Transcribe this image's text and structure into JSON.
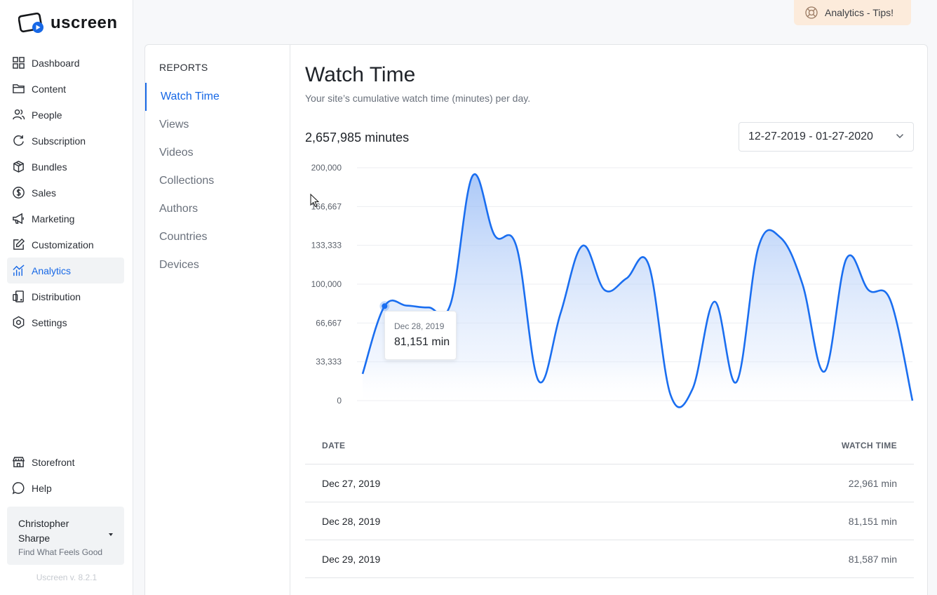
{
  "app": {
    "logo_text": "uscreen",
    "version": "Uscreen v. 8.2.1"
  },
  "sidebar": {
    "items": [
      {
        "label": "Dashboard",
        "icon": "grid-icon"
      },
      {
        "label": "Content",
        "icon": "folder-icon"
      },
      {
        "label": "People",
        "icon": "people-icon"
      },
      {
        "label": "Subscription",
        "icon": "refresh-icon"
      },
      {
        "label": "Bundles",
        "icon": "box-icon"
      },
      {
        "label": "Sales",
        "icon": "dollar-icon"
      },
      {
        "label": "Marketing",
        "icon": "megaphone-icon"
      },
      {
        "label": "Customization",
        "icon": "edit-icon"
      },
      {
        "label": "Analytics",
        "icon": "chart-icon",
        "active": true
      },
      {
        "label": "Distribution",
        "icon": "devices-icon"
      },
      {
        "label": "Settings",
        "icon": "hexagon-gear-icon"
      }
    ],
    "bottom": [
      {
        "label": "Storefront",
        "icon": "store-icon"
      },
      {
        "label": "Help",
        "icon": "chat-icon"
      }
    ],
    "user": {
      "name": "Christopher Sharpe",
      "subtitle": "Find What Feels Good"
    }
  },
  "header": {
    "tips_label": "Analytics - Tips!"
  },
  "reports": {
    "title": "REPORTS",
    "items": [
      "Watch Time",
      "Views",
      "Videos",
      "Collections",
      "Authors",
      "Countries",
      "Devices"
    ],
    "active": "Watch Time"
  },
  "main": {
    "title": "Watch Time",
    "subtitle": "Your site’s cumulative watch time (minutes) per day.",
    "total": "2,657,985 minutes",
    "date_range": "12-27-2019 - 01-27-2020"
  },
  "tooltip": {
    "date": "Dec 28, 2019",
    "value": "81,151 min"
  },
  "table": {
    "headers": {
      "date": "DATE",
      "watch_time": "WATCH TIME"
    },
    "rows": [
      {
        "date": "Dec 27, 2019",
        "value": "22,961 min"
      },
      {
        "date": "Dec 28, 2019",
        "value": "81,151 min"
      },
      {
        "date": "Dec 29, 2019",
        "value": "81,587 min"
      }
    ]
  },
  "colors": {
    "accent": "#1768e6",
    "line": "#1a6ef0",
    "tips_bg": "#fcebdb"
  },
  "chart_data": {
    "type": "area",
    "title": "",
    "xlabel": "",
    "ylabel": "",
    "ylim": [
      0,
      200000
    ],
    "yticks": [
      0,
      33333,
      66667,
      100000,
      133333,
      166667,
      200000
    ],
    "ytick_labels": [
      "0",
      "33,333",
      "66,667",
      "100,000",
      "133,333",
      "166,667",
      "200,000"
    ],
    "x": [
      "2019-12-27",
      "2019-12-28",
      "2019-12-29",
      "2019-12-30",
      "2019-12-31",
      "2020-01-01",
      "2020-01-02",
      "2020-01-03",
      "2020-01-04",
      "2020-01-05",
      "2020-01-06",
      "2020-01-07",
      "2020-01-08",
      "2020-01-09",
      "2020-01-10",
      "2020-01-11",
      "2020-01-12",
      "2020-01-13",
      "2020-01-14",
      "2020-01-15",
      "2020-01-16",
      "2020-01-17",
      "2020-01-18",
      "2020-01-19",
      "2020-01-20",
      "2020-01-21",
      "2020-01-22",
      "2020-01-23",
      "2020-01-24",
      "2020-01-25",
      "2020-01-26",
      "2020-01-27"
    ],
    "series": [
      {
        "values": [
          22961,
          81151,
          81587,
          80000,
          83000,
          193000,
          142000,
          132000,
          17000,
          75000,
          133000,
          95000,
          105000,
          117000,
          5000,
          10000,
          85000,
          16000,
          132000,
          140000,
          100000,
          25000,
          122000,
          95000,
          86000,
          0,
          0,
          0,
          0,
          0,
          0,
          0
        ]
      }
    ],
    "grid": true
  }
}
